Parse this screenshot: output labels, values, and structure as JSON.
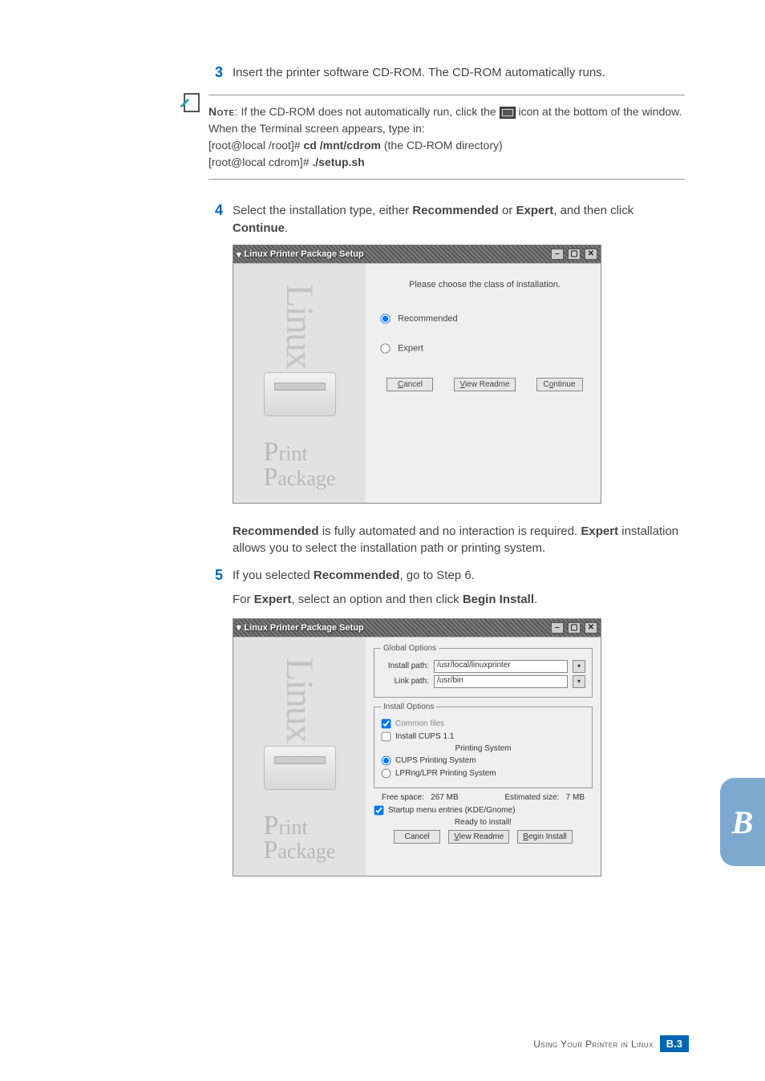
{
  "steps": {
    "s3": {
      "num": "3",
      "text_a": "Insert the printer software CD-ROM. The CD-ROM automatically runs."
    },
    "s4": {
      "num": "4",
      "text_pre": "Select the installation type, either ",
      "bold1": "Recommended",
      "mid": " or ",
      "bold2": "Expert",
      "text_post": ", and then click ",
      "bold3": "Continue",
      "end": "."
    },
    "s5": {
      "num": "5",
      "line1_pre": "If you selected ",
      "line1_b": "Recommended",
      "line1_post": ", go to Step 6.",
      "line2_pre": "For ",
      "line2_b1": "Expert",
      "line2_mid": ", select an option and then click ",
      "line2_b2": "Begin Install",
      "line2_end": "."
    }
  },
  "note": {
    "label": "Note",
    "line1_pre": ": If the CD-ROM does not automatically run, click the ",
    "line1_post": " icon at the bottom of the window. When the Terminal screen appears, type in:",
    "cmd1_pre": "[root@local /root]# ",
    "cmd1_b": "cd /mnt/cdrom",
    "cmd1_post": " (the CD-ROM directory)",
    "cmd2_pre": "[root@local cdrom]# ",
    "cmd2_b": "./setup.sh"
  },
  "para_after_ss1": {
    "b1": "Recommended",
    "t1": " is fully automated and no interaction is required. ",
    "b2": "Expert",
    "t2": " installation allows you to select the installation path or printing system."
  },
  "ss1": {
    "title": "Linux Printer Package Setup",
    "prompt": "Please choose the class of installation.",
    "opt1": "Recommended",
    "opt2": "Expert",
    "btn_cancel": "Cancel",
    "btn_readme": "View Readme",
    "btn_continue": "Continue",
    "left_linux": "Linux",
    "left_print": "Print",
    "left_pkg": "Package"
  },
  "ss2": {
    "title": "Linux Printer Package Setup",
    "global_legend": "Global Options",
    "install_path_lbl": "Install path:",
    "install_path_val": "/usr/local/linuxprinter",
    "link_path_lbl": "Link path:",
    "link_path_val": "/usr/bin",
    "install_opts_legend": "Install Options",
    "chk_common": "Common files",
    "chk_cups11": "Install CUPS 1.1",
    "printing_system_hdr": "Printing System",
    "rad_cups": "CUPS Printing System",
    "rad_lprng": "LPRng/LPR Printing System",
    "free_space_lbl": "Free space:",
    "free_space_val": "267 MB",
    "est_size_lbl": "Estimated size:",
    "est_size_val": "7 MB",
    "chk_startup": "Startup menu entries (KDE/Gnome)",
    "ready": "Ready to install!",
    "btn_cancel": "Cancel",
    "btn_readme": "View Readme",
    "btn_begin": "Begin Install"
  },
  "footer": {
    "text": "Using Your Printer in Linux",
    "page_b": "B.",
    "page_n": "3"
  },
  "sidetab": "B"
}
